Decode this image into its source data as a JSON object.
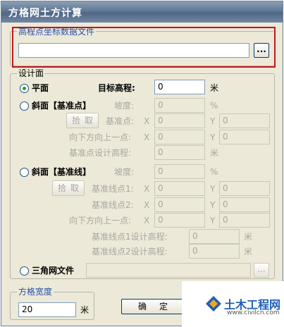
{
  "window": {
    "title": "方格网土方计算"
  },
  "elevation_file": {
    "group_label": "高程点坐标数据文件",
    "path_value": "",
    "browse_label": "..."
  },
  "design_surface": {
    "group_label": "设计面",
    "plane": {
      "label": "平面",
      "target_label": "目标高程:",
      "target_value": "0",
      "unit": "米"
    },
    "slope_point": {
      "label": "斜面【基准点】",
      "slope_label": "坡度:",
      "slope_value": "0",
      "slope_unit": "%",
      "pick_label": "拾取",
      "base_label": "基准点:",
      "base_x_label": "X",
      "base_x_value": "0",
      "base_y_label": "Y",
      "base_y_value": "0",
      "down_label": "向下方向上一点:",
      "down_x_label": "X",
      "down_x_value": "0",
      "down_y_label": "Y",
      "down_y_value": "0",
      "design_label": "基准点设计高程:",
      "design_value": "0",
      "design_unit": "米"
    },
    "slope_line": {
      "label": "斜面【基准线】",
      "slope_label": "坡度:",
      "slope_value": "0",
      "slope_unit": "%",
      "pick_label": "拾取",
      "p1_label": "基准线点1:",
      "p1_x_label": "X",
      "p1_x_value": "0",
      "p1_y_label": "Y",
      "p1_y_value": "0",
      "p2_label": "基准线点2:",
      "p2_x_label": "X",
      "p2_x_value": "0",
      "p2_y_label": "Y",
      "p2_y_value": "0",
      "down_label": "向下方向上一点:",
      "down_x_label": "X",
      "down_x_value": "0",
      "down_y_label": "Y",
      "down_y_value": "0",
      "p1_design_label": "基准线点1设计高程:",
      "p1_design_value": "0",
      "p1_design_unit": "米",
      "p2_design_label": "基准线点2设计高程:",
      "p2_design_value": "0",
      "p2_design_unit": "米"
    },
    "tin": {
      "label": "三角网文件",
      "path_value": "",
      "browse_label": "..."
    }
  },
  "grid_width": {
    "group_label": "方格宽度",
    "value": "20",
    "unit": "米"
  },
  "buttons": {
    "ok_label": "确定"
  },
  "watermark": {
    "name": "土木工程网",
    "url": "www.civilcn.com"
  },
  "colors": {
    "highlight": "#c4161c",
    "title_bar": "#607794",
    "accent_text": "#2750a8"
  }
}
